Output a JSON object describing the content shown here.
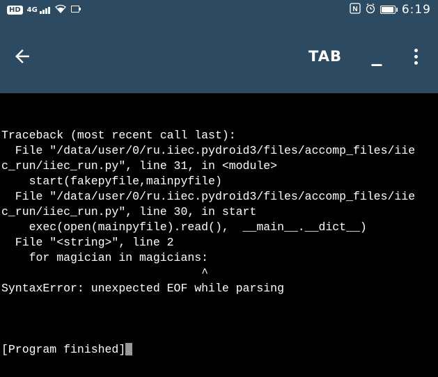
{
  "status_bar": {
    "hd_label": "HD",
    "network_label": "4G",
    "nfc_label": "N",
    "time": "6:19"
  },
  "app_bar": {
    "tab_label": "TAB",
    "underscore_label": "_"
  },
  "terminal": {
    "lines": [
      "Traceback (most recent call last):",
      "  File \"/data/user/0/ru.iiec.pydroid3/files/accomp_files/iie",
      "c_run/iiec_run.py\", line 31, in <module>",
      "    start(fakepyfile,mainpyfile)",
      "  File \"/data/user/0/ru.iiec.pydroid3/files/accomp_files/iie",
      "c_run/iiec_run.py\", line 30, in start",
      "    exec(open(mainpyfile).read(),  __main__.__dict__)",
      "  File \"<string>\", line 2",
      "    for magician in magicians:",
      "                             ^",
      "SyntaxError: unexpected EOF while parsing",
      ""
    ],
    "finished_text": "[Program finished]"
  }
}
